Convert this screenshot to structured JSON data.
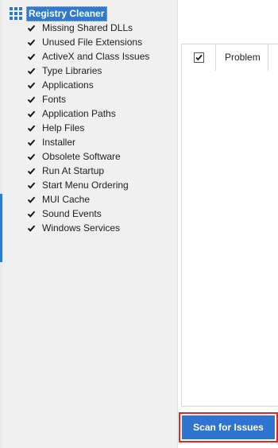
{
  "tree": {
    "root_label": "Registry Cleaner",
    "root_icon": "grid-icon",
    "items": [
      {
        "label": "Missing Shared DLLs",
        "checked": true
      },
      {
        "label": "Unused File Extensions",
        "checked": true
      },
      {
        "label": "ActiveX and Class Issues",
        "checked": true
      },
      {
        "label": "Type Libraries",
        "checked": true
      },
      {
        "label": "Applications",
        "checked": true
      },
      {
        "label": "Fonts",
        "checked": true
      },
      {
        "label": "Application Paths",
        "checked": true
      },
      {
        "label": "Help Files",
        "checked": true
      },
      {
        "label": "Installer",
        "checked": true
      },
      {
        "label": "Obsolete Software",
        "checked": true
      },
      {
        "label": "Run At Startup",
        "checked": true
      },
      {
        "label": "Start Menu Ordering",
        "checked": true
      },
      {
        "label": "MUI Cache",
        "checked": true
      },
      {
        "label": "Sound Events",
        "checked": true
      },
      {
        "label": "Windows Services",
        "checked": true
      }
    ]
  },
  "results_table": {
    "select_all_checked": true,
    "columns": [
      "Problem"
    ]
  },
  "actions": {
    "scan_label": "Scan for Issues"
  },
  "colors": {
    "accent": "#2e7ad1",
    "button": "#2f74d0",
    "highlight_outline": "#e0262b"
  }
}
